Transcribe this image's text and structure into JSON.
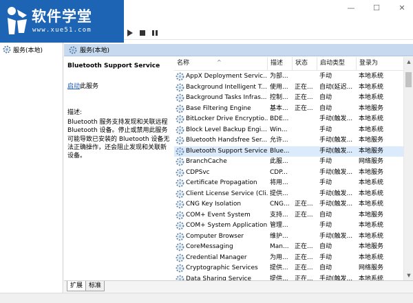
{
  "logo": {
    "title": "软件学堂",
    "url": "www.xue51.com"
  },
  "window": {
    "minimize": "—",
    "maximize": "☐",
    "close": "✕"
  },
  "tree": {
    "item": "服务(本地)"
  },
  "pane": {
    "header": "服务(本地)"
  },
  "description": {
    "service_name": "Bluetooth Support Service",
    "start_link": "启动",
    "start_suffix": "此服务",
    "label": "描述:",
    "text": "Bluetooth 服务支持发现和关联远程 Bluetooth 设备。停止或禁用此服务可能导致已安装的 Bluetooth 设备无法正确操作，还会阻止发现和关联新设备。"
  },
  "table": {
    "columns": [
      "名称",
      "描述",
      "状态",
      "启动类型",
      "登录为"
    ],
    "rows": [
      [
        "AppX Deployment Servic...",
        "为部...",
        "",
        "手动",
        "本地系统"
      ],
      [
        "Background Intelligent T...",
        "使用...",
        "正在...",
        "自动(延迟...",
        "本地系统"
      ],
      [
        "Background Tasks Infras...",
        "控制...",
        "正在...",
        "自动",
        "本地系统"
      ],
      [
        "Base Filtering Engine",
        "基本...",
        "正在...",
        "自动",
        "本地服务"
      ],
      [
        "BitLocker Drive Encryptio...",
        "BDE...",
        "",
        "手动(触发...",
        "本地系统"
      ],
      [
        "Block Level Backup Engi...",
        "Win...",
        "",
        "手动",
        "本地系统"
      ],
      [
        "Bluetooth Handsfree Ser...",
        "允许...",
        "",
        "手动(触发...",
        "本地服务"
      ],
      [
        "Bluetooth Support Service",
        "Blue...",
        "",
        "手动(触发...",
        "本地服务"
      ],
      [
        "BranchCache",
        "此服...",
        "",
        "手动",
        "网络服务"
      ],
      [
        "CDPSvc",
        "CDP...",
        "",
        "手动(触发...",
        "本地服务"
      ],
      [
        "Certificate Propagation",
        "将用...",
        "",
        "手动",
        "本地系统"
      ],
      [
        "Client License Service (Cli...",
        "提供...",
        "",
        "手动(触发...",
        "本地系统"
      ],
      [
        "CNG Key Isolation",
        "CNG...",
        "正在...",
        "手动(触发...",
        "本地系统"
      ],
      [
        "COM+ Event System",
        "支持...",
        "正在...",
        "自动",
        "本地服务"
      ],
      [
        "COM+ System Application",
        "管理...",
        "",
        "手动",
        "本地系统"
      ],
      [
        "Computer Browser",
        "维护...",
        "",
        "手动(触发...",
        "本地系统"
      ],
      [
        "CoreMessaging",
        "Man...",
        "正在...",
        "自动",
        "本地服务"
      ],
      [
        "Credential Manager",
        "为用...",
        "正在...",
        "手动",
        "本地系统"
      ],
      [
        "Cryptographic Services",
        "提供...",
        "正在...",
        "自动",
        "网络服务"
      ],
      [
        "Data Sharing Service",
        "提供...",
        "正在...",
        "手动(触发...",
        "本地系统"
      ]
    ],
    "selected_index": 7
  },
  "tabs": [
    "扩展",
    "标准"
  ],
  "colors": {
    "header_bg": "#c6d9ee",
    "selected_row": "#dcebfb",
    "link": "#1a55b8",
    "logo_bg": "#1e64b4"
  }
}
